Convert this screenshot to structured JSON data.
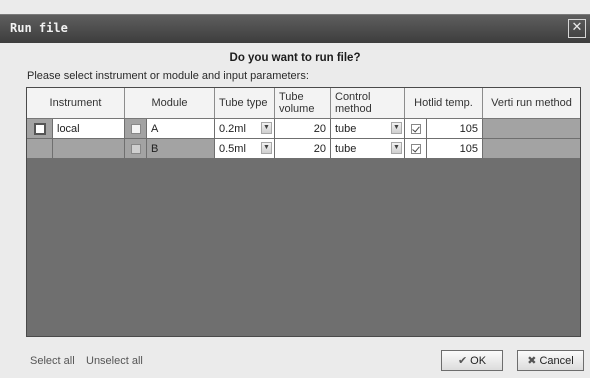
{
  "window": {
    "title": "Run file",
    "close_glyph": "✕"
  },
  "question": "Do you want to run file?",
  "prompt": "Please select instrument or module and input parameters:",
  "table": {
    "headers": {
      "instrument": "Instrument",
      "module": "Module",
      "tube_type": "Tube type",
      "tube_volume": "Tube volume",
      "control_method": "Control method",
      "hotlid_temp": "Hotlid temp.",
      "verti_run_method": "Verti run method"
    },
    "rows": [
      {
        "instrument": "local",
        "module": "A",
        "tube_type": "0.2ml",
        "tube_volume": "20",
        "control_method": "tube",
        "hotlid_temp": "105"
      },
      {
        "instrument": "",
        "module": "B",
        "tube_type": "0.5ml",
        "tube_volume": "20",
        "control_method": "tube",
        "hotlid_temp": "105"
      }
    ]
  },
  "footer": {
    "select_all": "Select all",
    "unselect_all": "Unselect all",
    "ok_label": "OK",
    "cancel_label": "Cancel"
  },
  "icons": {
    "ok": "check-icon",
    "cancel": "cross-icon"
  }
}
